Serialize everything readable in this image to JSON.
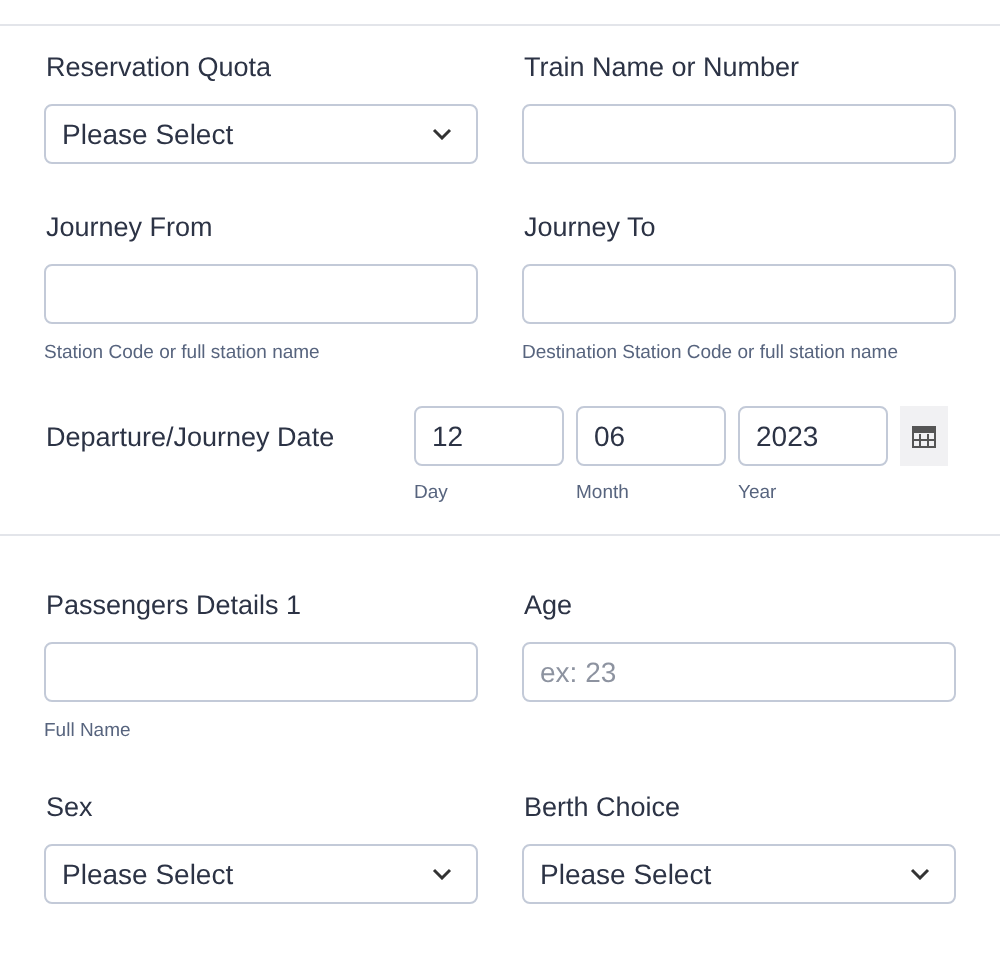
{
  "sections": [
    {
      "rows": [
        [
          {
            "kind": "select",
            "label": "Reservation Quota",
            "value": "Please Select"
          },
          {
            "kind": "text",
            "label": "Train Name or Number"
          }
        ],
        [
          {
            "kind": "text",
            "label": "Journey From",
            "help": "Station Code or full station name"
          },
          {
            "kind": "text",
            "label": "Journey To",
            "help": "Destination Station Code or full station name"
          }
        ]
      ],
      "date": {
        "label": "Departure/Journey Date",
        "parts": [
          {
            "value": "12",
            "help": "Day"
          },
          {
            "value": "06",
            "help": "Month"
          },
          {
            "value": "2023",
            "help": "Year"
          }
        ]
      }
    },
    {
      "rows": [
        [
          {
            "kind": "text",
            "label": "Passengers Details 1",
            "help": "Full Name"
          },
          {
            "kind": "text",
            "label": "Age",
            "placeholder": "ex: 23"
          }
        ],
        [
          {
            "kind": "select",
            "label": "Sex",
            "value": "Please Select"
          },
          {
            "kind": "select",
            "label": "Berth Choice",
            "value": "Please Select"
          }
        ]
      ]
    }
  ]
}
